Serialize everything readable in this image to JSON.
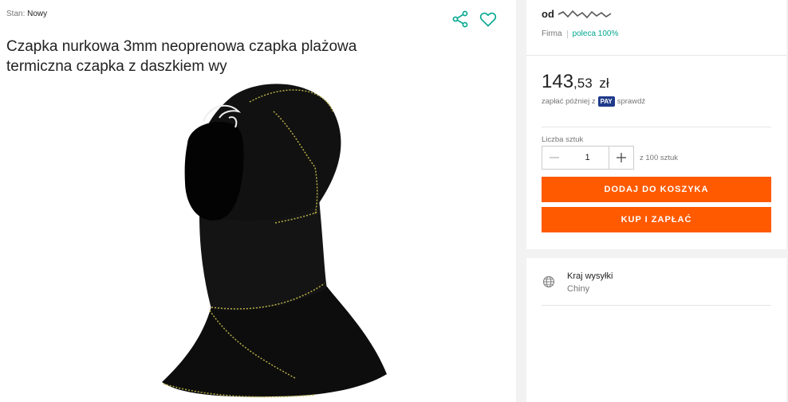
{
  "product": {
    "condition_label": "Stan:",
    "condition_value": "Nowy",
    "title": "Czapka nurkowa 3mm neoprenowa czapka plażowa termiczna czapka z daszkiem wy",
    "image_icon": "diving-hood-photo"
  },
  "actions": {
    "share_icon": "share-icon",
    "favorite_icon": "heart-icon"
  },
  "seller": {
    "prefix": "od",
    "type": "Firma",
    "recommend": "poleca 100%"
  },
  "price": {
    "integer": "143",
    "decimal": ",53",
    "currency": "zł",
    "pay_later_prefix": "zapłać później z",
    "pay_badge": "PAY",
    "pay_later_link": "sprawdź"
  },
  "quantity": {
    "label": "Liczba sztuk",
    "value": "1",
    "of_label": "z 100 sztuk"
  },
  "buttons": {
    "add_to_cart": "DODAJ DO KOSZYKA",
    "buy_now": "KUP I ZAPŁAĆ"
  },
  "shipping": {
    "icon": "globe-icon",
    "label": "Kraj wysyłki",
    "value": "Chiny"
  },
  "colors": {
    "accent": "#ff5a00",
    "teal": "#00a790",
    "pay_badge": "#1f3a8a"
  }
}
